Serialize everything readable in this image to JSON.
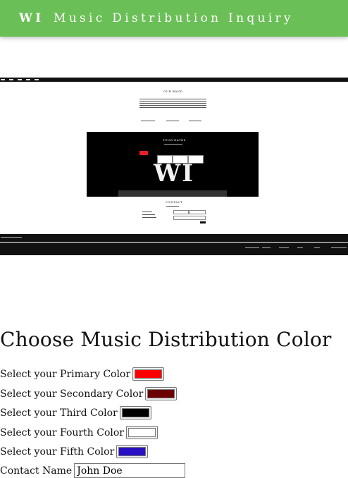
{
  "header": {
    "brand": "WI",
    "title": "Music Distribution Inquiry"
  },
  "preview": {
    "overlay_text": "WI",
    "section_headings": [
      "OUR BAND",
      "TOUR DATES",
      "CONTACT"
    ]
  },
  "form": {
    "heading": "Choose Music Distribution Color",
    "colors": [
      {
        "label": "Select your Primary Color",
        "value": "#ff0000"
      },
      {
        "label": "Select your Secondary Color",
        "value": "#6b0000"
      },
      {
        "label": "Select your Third Color",
        "value": "#000000"
      },
      {
        "label": "Select your Fourth Color",
        "value": "#ffffff"
      },
      {
        "label": "Select your Fifth Color",
        "value": "#2a10c4"
      }
    ],
    "contact_label": "Contact Name",
    "contact_value": "John Doe"
  },
  "theme": {
    "header_color": "#6bbf57"
  }
}
